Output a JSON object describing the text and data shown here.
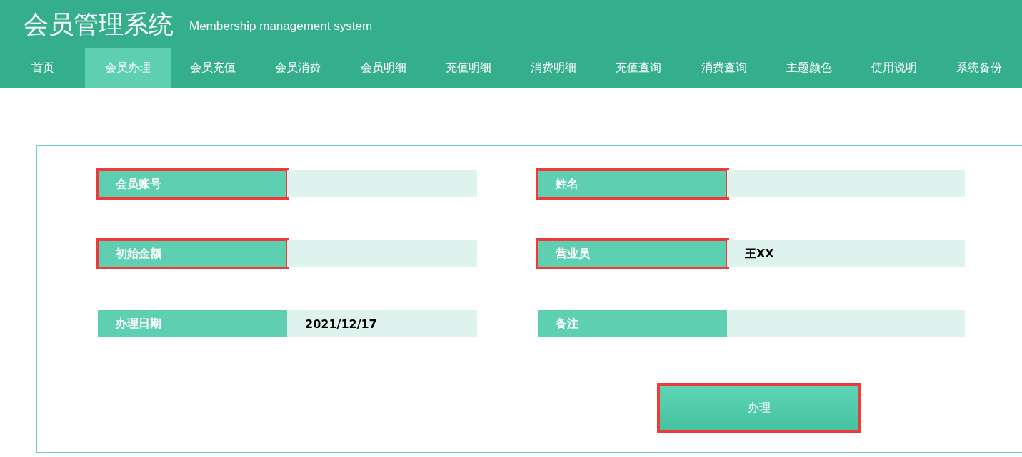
{
  "header": {
    "title": "会员管理系统",
    "subtitle": "Membership management system"
  },
  "nav": [
    {
      "label": "首页",
      "selected": false
    },
    {
      "label": "会员办理",
      "selected": true
    },
    {
      "label": "会员充值",
      "selected": false
    },
    {
      "label": "会员消费",
      "selected": false
    },
    {
      "label": "会员明细",
      "selected": false
    },
    {
      "label": "充值明细",
      "selected": false
    },
    {
      "label": "消费明细",
      "selected": false
    },
    {
      "label": "充值查询",
      "selected": false
    },
    {
      "label": "消费查询",
      "selected": false
    },
    {
      "label": "主题颜色",
      "selected": false
    },
    {
      "label": "使用说明",
      "selected": false
    },
    {
      "label": "系统备份",
      "selected": false
    }
  ],
  "form": {
    "fields": [
      {
        "label": "会员账号",
        "highlighted": true
      },
      {
        "label": "姓名",
        "highlighted": true
      },
      {
        "label": "初始金额",
        "highlighted": true
      },
      {
        "label": "营业员",
        "value": "王XX",
        "highlighted": true
      },
      {
        "label": "办理日期",
        "value": "2021/12/17",
        "highlighted": false
      },
      {
        "label": "备注",
        "highlighted": false
      }
    ],
    "submit": {
      "label": "办理",
      "highlighted": true
    }
  }
}
